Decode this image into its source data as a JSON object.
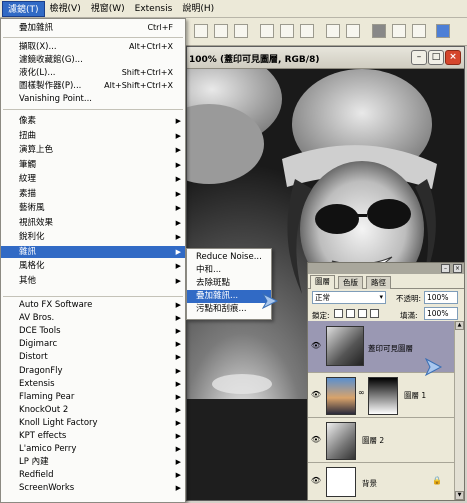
{
  "menubar": {
    "items": [
      "濾鏡(T)",
      "檢視(V)",
      "視窗(W)",
      "Extensis",
      "說明(H)"
    ]
  },
  "document": {
    "title": "100% (蓋印可見圖層, RGB/8)"
  },
  "filter_menu": {
    "top": [
      {
        "label": "疊加雜訊",
        "shortcut": "Ctrl+F"
      }
    ],
    "group2": [
      {
        "label": "擷取(X)...",
        "shortcut": "Alt+Ctrl+X"
      },
      {
        "label": "濾鏡收藏館(G)..."
      },
      {
        "label": "液化(L)...",
        "shortcut": "Shift+Ctrl+X"
      },
      {
        "label": "圖樣製作器(P)...",
        "shortcut": "Alt+Shift+Ctrl+X"
      },
      {
        "label": "Vanishing Point..."
      }
    ],
    "group3": [
      "像素",
      "扭曲",
      "演算上色",
      "筆觸",
      "紋理",
      "素描",
      "藝術風",
      "視訊效果",
      "銳利化",
      "雜訊",
      "風格化",
      "其他"
    ],
    "highlighted": "雜訊",
    "group4": [
      "Auto FX Software",
      "AV Bros.",
      "DCE Tools",
      "Digimarc",
      "Distort",
      "DragonFly",
      "Extensis",
      "Flaming Pear",
      "KnockOut 2",
      "Knoll Light Factory",
      "KPT effects",
      "L'amico Perry",
      "LP 內建",
      "Redfield",
      "ScreenWorks"
    ]
  },
  "noise_submenu": {
    "items": [
      "Reduce Noise...",
      "中和...",
      "去除斑點",
      "疊加雜訊...",
      "污點和刮痕..."
    ],
    "highlighted": "疊加雜訊..."
  },
  "layers_panel": {
    "tabs": [
      "圖層",
      "色版",
      "路徑"
    ],
    "blend_mode": "正常",
    "opacity_label": "不透明:",
    "opacity_value": "100%",
    "lock_label": "鎖定:",
    "fill_label": "填滿:",
    "fill_value": "100%",
    "layers": [
      {
        "name": "蓋印可見圖層",
        "selected": true
      },
      {
        "name": "圖層 1",
        "selected": false
      },
      {
        "name": "圖層 2",
        "selected": false
      },
      {
        "name": "背景",
        "selected": false
      }
    ]
  },
  "icons": {
    "submenu_arrow": "chevron-right-icon",
    "eye": "eye-icon",
    "pointer": "cursor-arrow-icon",
    "lock": "lock-icon"
  },
  "colors": {
    "menu_highlight": "#316ac5",
    "selected_layer": "#9a98b3",
    "close_button": "#d5462c"
  }
}
